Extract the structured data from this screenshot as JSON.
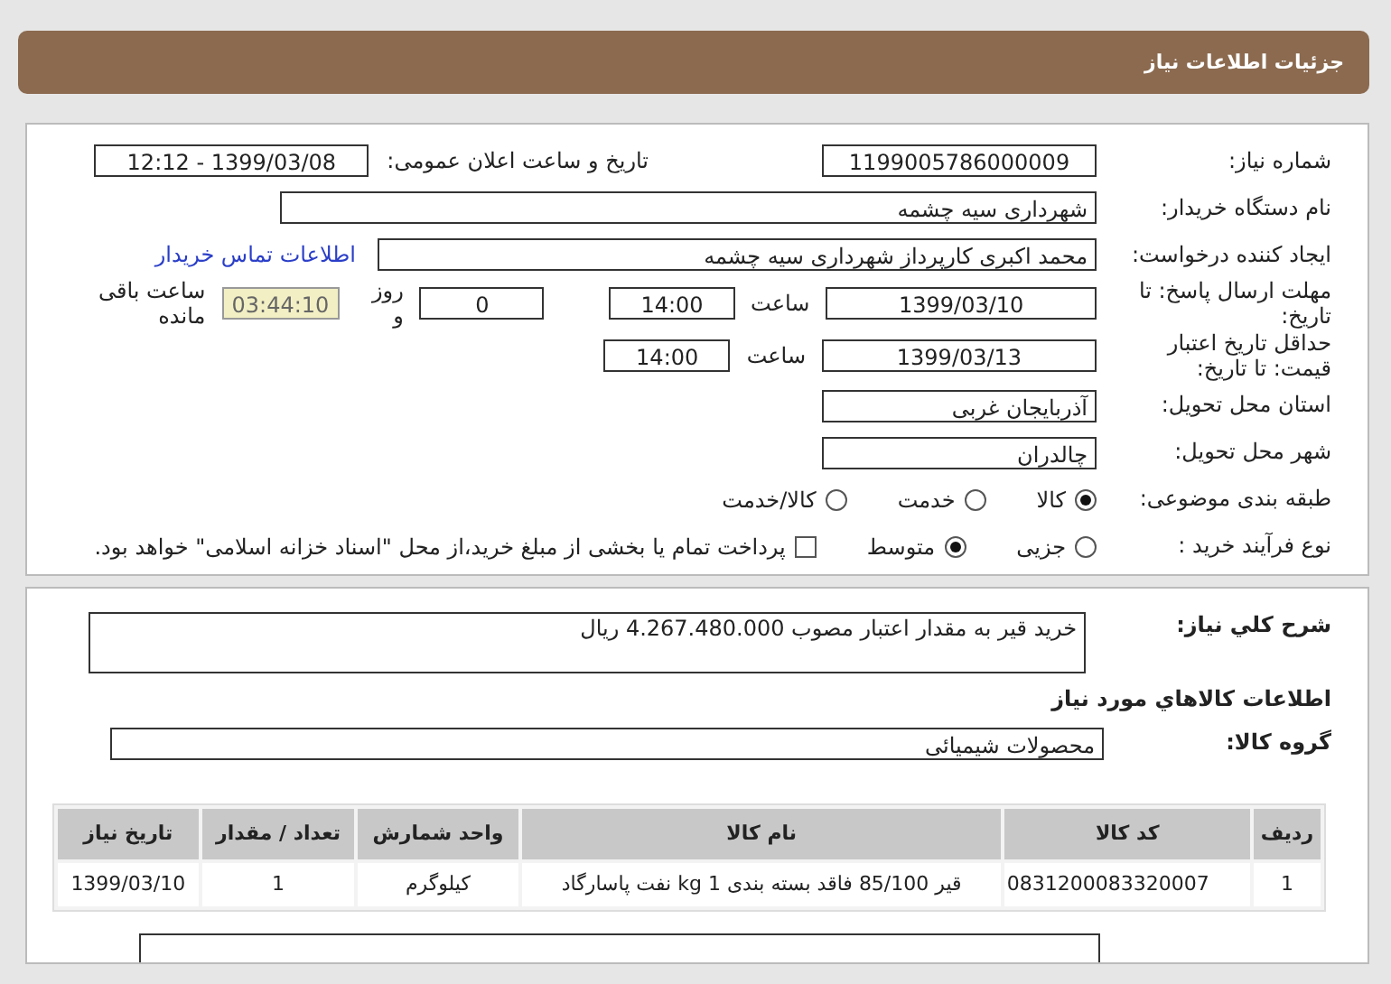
{
  "header": {
    "title": "جزئیات اطلاعات نیاز"
  },
  "details": {
    "need_number": {
      "label": "شماره نیاز:",
      "value": "1199005786000009"
    },
    "announce": {
      "label": "تاریخ و ساعت اعلان عمومی:",
      "value": "1399/03/08 - 12:12"
    },
    "buyer": {
      "label": "نام دستگاه خریدار:",
      "value": "شهرداری سیه چشمه"
    },
    "creator": {
      "label": "ایجاد کننده درخواست:",
      "value": "محمد اکبری کارپرداز شهرداری سیه چشمه"
    },
    "contact_link": "اطلاعات تماس خریدار",
    "deadline": {
      "label": "مهلت ارسال پاسخ: تا تاریخ:",
      "date": "1399/03/10",
      "time_label": "ساعت",
      "time": "14:00",
      "days": "0",
      "days_label": "روز و",
      "remaining": "03:44:10",
      "remaining_label": "ساعت باقی مانده"
    },
    "validity": {
      "label": "حداقل تاریخ اعتبار قیمت: تا تاریخ:",
      "date": "1399/03/13",
      "time_label": "ساعت",
      "time": "14:00"
    },
    "province": {
      "label": "استان محل تحویل:",
      "value": "آذربایجان غربی"
    },
    "city": {
      "label": "شهر محل تحویل:",
      "value": "چالدران"
    },
    "category": {
      "label": "طبقه بندی موضوعی:",
      "options": [
        {
          "label": "کالا",
          "selected": true
        },
        {
          "label": "خدمت",
          "selected": false
        },
        {
          "label": "کالا/خدمت",
          "selected": false
        }
      ]
    },
    "purchase": {
      "label": "نوع فرآیند خرید :",
      "options": [
        {
          "label": "جزیی",
          "selected": false
        },
        {
          "label": "متوسط",
          "selected": true
        }
      ],
      "payment": {
        "checked": false,
        "label": "پرداخت تمام یا بخشی از مبلغ خرید،از محل \"اسناد خزانه اسلامی\" خواهد بود."
      }
    }
  },
  "description": {
    "label": "شرح کلي نياز:",
    "value": "خرید قیر به مقدار اعتبار مصوب 4.267.480.000 ریال"
  },
  "goods_heading": "اطلاعات کالاهاي مورد نياز",
  "goods_group": {
    "label": "گروه کالا:",
    "value": "محصولات شیمیائی"
  },
  "table": {
    "columns": [
      "ردیف",
      "کد کالا",
      "نام کالا",
      "واحد شمارش",
      "تعداد / مقدار",
      "تاریخ نیاز"
    ],
    "rows": [
      [
        "1",
        "0831200083320007",
        "قیر 85/100 فاقد بسته بندی 1 kg نفت پاسارگاد",
        "کیلوگرم",
        "1",
        "1399/03/10"
      ]
    ]
  }
}
